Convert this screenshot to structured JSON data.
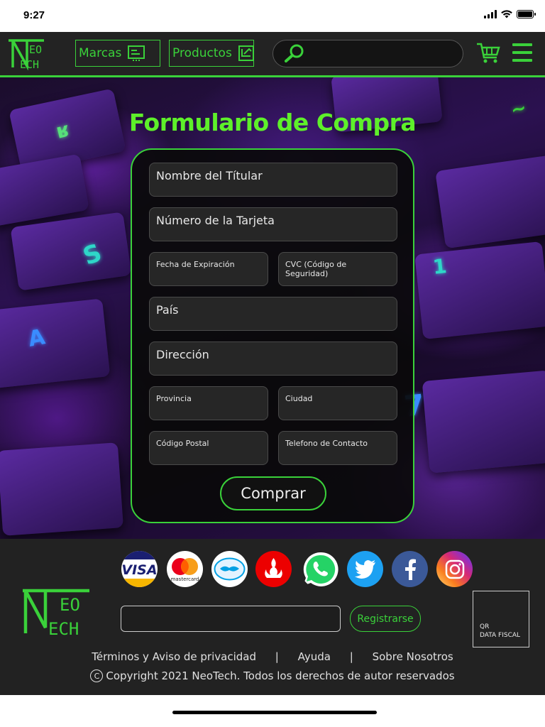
{
  "status_bar": {
    "time": "9:27"
  },
  "header": {
    "logo_text_top": "EO",
    "logo_text_bottom": "ECH",
    "nav_marcas": "Marcas",
    "nav_productos": "Productos",
    "search_placeholder": "",
    "accent_color": "#3ad13a"
  },
  "hero": {
    "title": "Formulario de Compra",
    "fields": {
      "nombre_titular": "Nombre del Títular",
      "numero_tarjeta": "Número de la Tarjeta",
      "fecha_expiracion": "Fecha de Expiración",
      "cvc": "CVC (Código de Seguridad)",
      "pais": "País",
      "direccion": "Dirección",
      "provincia": "Provincia",
      "ciudad": "Ciudad",
      "codigo_postal": "Código Postal",
      "telefono": "Telefono de Contacto"
    },
    "submit_label": "Comprar"
  },
  "footer": {
    "payment_icons": [
      "visa-icon",
      "mastercard-icon",
      "mercadopago-icon",
      "santander-icon",
      "whatsapp-icon",
      "twitter-icon",
      "facebook-icon",
      "instagram-icon"
    ],
    "visa_text": "VISA",
    "mastercard_text": "mastercard",
    "logo_text_top": "EO",
    "logo_text_bottom": "ECH",
    "email_value": "",
    "register_label": "Registrarse",
    "qr_line1": "QR",
    "qr_line2": "DATA FISCAL",
    "links": {
      "terminos": "Términos y Aviso de privacidad",
      "sep1": "|",
      "ayuda": "Ayuda",
      "sep2": "|",
      "sobre": "Sobre Nosotros"
    },
    "copyright_symbol": "C",
    "copyright": "Copyright 2021 NeoTech. Todos los derechos de autor reservados"
  }
}
